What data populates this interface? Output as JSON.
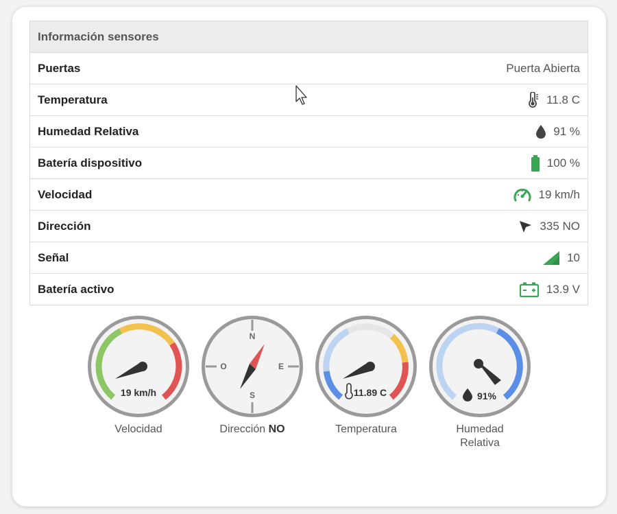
{
  "panel": {
    "title": "Información sensores",
    "rows": [
      {
        "label": "Puertas",
        "value": "Puerta Abierta",
        "icon": ""
      },
      {
        "label": "Temperatura",
        "value": "11.8 C",
        "icon": "thermometer-icon"
      },
      {
        "label": "Humedad Relativa",
        "value": "91 %",
        "icon": "water-drop-icon"
      },
      {
        "label": "Batería dispositivo",
        "value": "100 %",
        "icon": "battery-icon"
      },
      {
        "label": "Velocidad",
        "value": "19 km/h",
        "icon": "speedometer-icon"
      },
      {
        "label": "Dirección",
        "value": "335 NO",
        "icon": "direction-arrow-icon"
      },
      {
        "label": "Señal",
        "value": "10",
        "icon": "signal-icon"
      },
      {
        "label": "Batería activo",
        "value": "13.9 V",
        "icon": "car-battery-icon"
      }
    ]
  },
  "gauges": {
    "speed": {
      "readout": "19 km/h",
      "caption": "Velocidad"
    },
    "direction": {
      "caption_prefix": "Dirección",
      "caption_value": "NO",
      "n": "N",
      "s": "S",
      "e": "E",
      "o": "O"
    },
    "temperature": {
      "readout": "11.89 C",
      "caption": "Temperatura"
    },
    "humidity": {
      "readout": "91%",
      "caption_line1": "Humedad",
      "caption_line2": "Relativa"
    }
  },
  "colors": {
    "green": "#3aa655",
    "yellow": "#f2c14e",
    "red": "#e05454",
    "blue": "#5b8ee6",
    "light_blue": "#bcd4f2"
  }
}
